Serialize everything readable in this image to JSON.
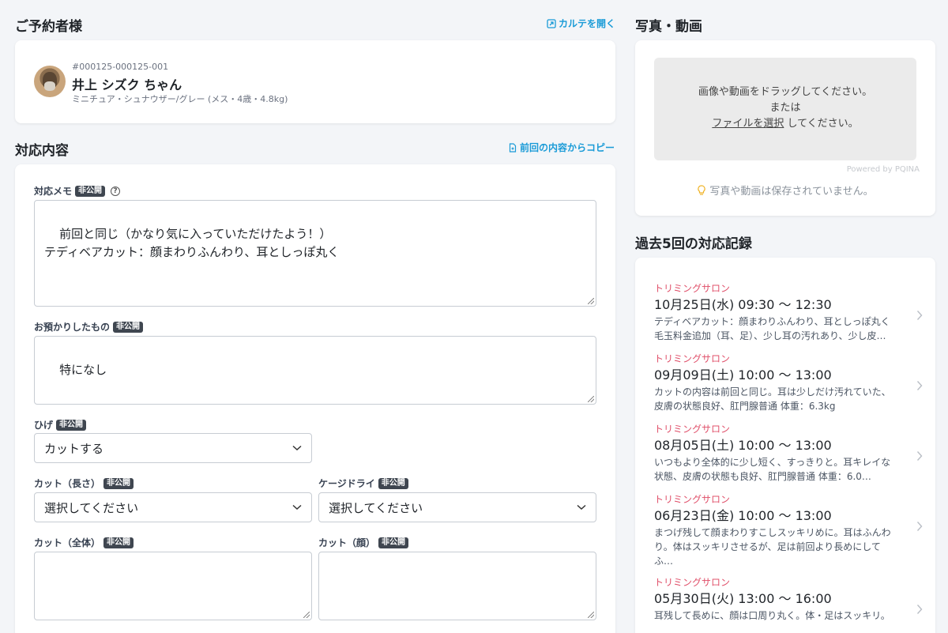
{
  "customer_section": {
    "title": "ご予約者様",
    "open_chart_label": "カルテを開く",
    "id": "#000125-000125-001",
    "name": "井上 シズク ちゃん",
    "breed": "ミニチュア・シュナウザー/グレー (メス・4歳・4.8kg)"
  },
  "content_section": {
    "title": "対応内容",
    "copy_label": "前回の内容からコピー",
    "private_badge": "非公開",
    "memo": {
      "label": "対応メモ",
      "value": "前回と同じ（かなり気に入っていただけたよう！）\nテディベアカット：顔まわりふんわり、耳としっぽ丸く"
    },
    "belongings": {
      "label": "お預かりしたもの",
      "value": "特になし"
    },
    "whiskers": {
      "label": "ひげ",
      "value": "カットする"
    },
    "cut_length": {
      "label": "カット（長さ）",
      "value": "選択してください"
    },
    "cage_dry": {
      "label": "ケージドライ",
      "value": "選択してください"
    },
    "cut_body": {
      "label": "カット（全体）",
      "value": ""
    },
    "cut_face": {
      "label": "カット（顔）",
      "value": ""
    }
  },
  "media_section": {
    "title": "写真・動画",
    "drop_line1": "画像や動画をドラッグしてください。",
    "drop_line2": "または",
    "file_link": "ファイルを選択",
    "drop_line3": " してください。",
    "powered_by": "Powered by PQINA",
    "notice": "写真や動画は保存されていません。"
  },
  "history_section": {
    "title": "過去5回の対応記録",
    "items": [
      {
        "category": "トリミングサロン",
        "date": "10月25日(水) 09:30 〜 12:30",
        "desc": "テディベアカット：顔まわりふんわり、耳としっぽ丸く毛玉料金追加（耳、足）、少し耳の汚れあり、少し皮…"
      },
      {
        "category": "トリミングサロン",
        "date": "09月09日(土) 10:00 〜 13:00",
        "desc": "カットの内容は前回と同じ。耳は少しだけ汚れていた、皮膚の状態良好、肛門腺普通 体重：6.3kg"
      },
      {
        "category": "トリミングサロン",
        "date": "08月05日(土) 10:00 〜 13:00",
        "desc": "いつもより全体的に少し短く、すっきりと。耳キレイな状態、皮膚の状態も良好、肛門腺普通 体重：6.0…"
      },
      {
        "category": "トリミングサロン",
        "date": "06月23日(金) 10:00 〜 13:00",
        "desc": "まつげ残して顔まわりすこしスッキリめに。耳はふんわり。体はスッキリさせるが、足は前回より長めにしてふ…"
      },
      {
        "category": "トリミングサロン",
        "date": "05月30日(火) 13:00 〜 16:00",
        "desc": "耳残して長めに、顔は口周り丸く。体・足はスッキリ。"
      }
    ]
  },
  "colors": {
    "accent": "#1a9bd7",
    "category": "#e0506a",
    "badge_bg": "#3f4650",
    "page_bg": "#f3f5f8"
  }
}
